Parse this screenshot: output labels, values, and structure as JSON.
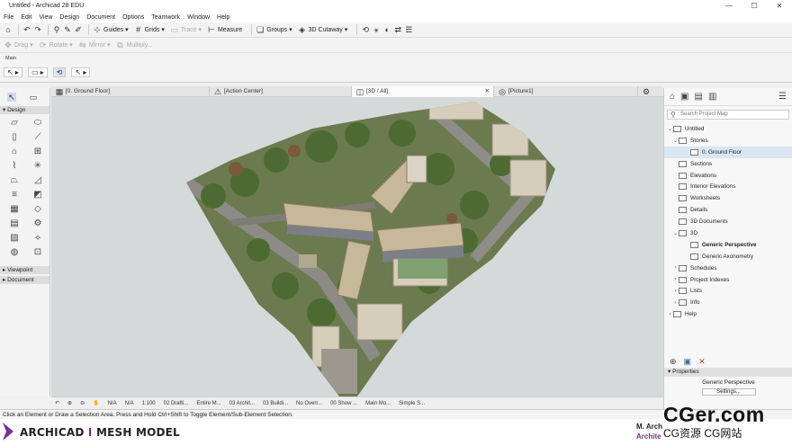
{
  "window": {
    "title": "Untitled - Archicad 28 EDU",
    "minimize": "—",
    "maximize": "☐",
    "close": "✕"
  },
  "menu": [
    "File",
    "Edit",
    "View",
    "Design",
    "Document",
    "Options",
    "Teamwork",
    "Window",
    "Help"
  ],
  "toolbar1": {
    "guides": "Guides",
    "grids": "Grids",
    "trace": "Trace",
    "measure": "Measure",
    "groups": "Groups",
    "cutaway": "3D Cutaway"
  },
  "toolbar2": {
    "drag": "Drag",
    "rotate": "Rotate",
    "mirror": "Mirror",
    "multiply": "Multiply..."
  },
  "info_box": {
    "label": "Main"
  },
  "toolbox": {
    "design": "Design",
    "viewpoint": "Viewpoint",
    "document": "Document"
  },
  "tabs": [
    {
      "label": "[0. Ground Floor]"
    },
    {
      "label": "[Action Center]"
    },
    {
      "label": "[3D / All]"
    },
    {
      "label": "[Picture1]"
    }
  ],
  "view_status": [
    "N/A",
    "N/A",
    "1:100",
    "02 Drafti...",
    "Entire M...",
    "03 Archit...",
    "03 Buildi...",
    "No Overr...",
    "00 Show ...",
    "Main Mo...",
    "Simple S..."
  ],
  "navigator": {
    "search_placeholder": "Search Project Map",
    "tree": [
      {
        "label": "Untitled",
        "level": 0,
        "toggle": "⌄"
      },
      {
        "label": "Stories",
        "level": 1,
        "toggle": "⌄"
      },
      {
        "label": "0. Ground Floor",
        "level": 2,
        "toggle": "",
        "selected": true
      },
      {
        "label": "Sections",
        "level": 1,
        "toggle": ""
      },
      {
        "label": "Elevations",
        "level": 1,
        "toggle": ""
      },
      {
        "label": "Interior Elevations",
        "level": 1,
        "toggle": ""
      },
      {
        "label": "Worksheets",
        "level": 1,
        "toggle": ""
      },
      {
        "label": "Details",
        "level": 1,
        "toggle": ""
      },
      {
        "label": "3D Documents",
        "level": 1,
        "toggle": ""
      },
      {
        "label": "3D",
        "level": 1,
        "toggle": "⌄"
      },
      {
        "label": "Generic Perspective",
        "level": 2,
        "toggle": "",
        "bold": true
      },
      {
        "label": "Generic Axonometry",
        "level": 2,
        "toggle": ""
      },
      {
        "label": "Schedules",
        "level": 1,
        "toggle": "›"
      },
      {
        "label": "Project Indexes",
        "level": 1,
        "toggle": "›"
      },
      {
        "label": "Lists",
        "level": 1,
        "toggle": "›"
      },
      {
        "label": "Info",
        "level": 1,
        "toggle": "›"
      },
      {
        "label": "Help",
        "level": 0,
        "toggle": "›"
      }
    ],
    "properties_label": "Properties",
    "properties_value": "Generic Perspective",
    "settings_button": "Settings..."
  },
  "status_line": "Click an Element or Draw a Selection Area. Press and Hold Ctrl+Shift to Toggle Element/Sub-Element Selection.",
  "banner": {
    "product": "ARCHICAD",
    "divider": "I",
    "subtitle": "MESH MODEL",
    "author_line1": "M. Arch",
    "author_line2": "Archite",
    "accent_color": "#7a2d8f"
  },
  "watermark": {
    "big": "CGer.com",
    "small": "CG资源  CG网站"
  }
}
